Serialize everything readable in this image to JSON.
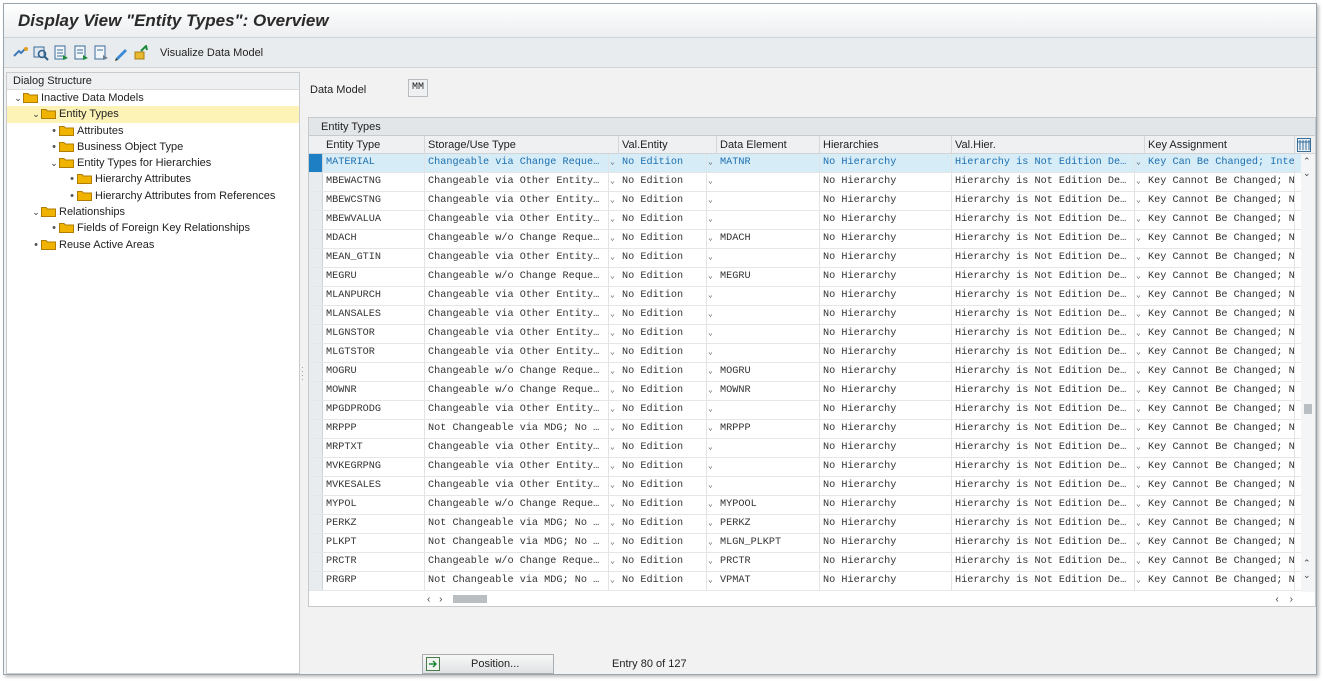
{
  "window": {
    "title": "Display View \"Entity Types\": Overview"
  },
  "toolbar": {
    "visualize_label": "Visualize Data Model"
  },
  "tree": {
    "header": "Dialog Structure",
    "items": [
      {
        "label": "Inactive Data Models",
        "level": 0,
        "expander": "open"
      },
      {
        "label": "Entity Types",
        "level": 1,
        "expander": "open",
        "selected": true
      },
      {
        "label": "Attributes",
        "level": 2,
        "expander": "leaf"
      },
      {
        "label": "Business Object Type",
        "level": 2,
        "expander": "leaf"
      },
      {
        "label": "Entity Types for Hierarchies",
        "level": 2,
        "expander": "open"
      },
      {
        "label": "Hierarchy Attributes",
        "level": 3,
        "expander": "leaf"
      },
      {
        "label": "Hierarchy Attributes from References",
        "level": 3,
        "expander": "leaf"
      },
      {
        "label": "Relationships",
        "level": 1,
        "expander": "open"
      },
      {
        "label": "Fields of Foreign Key Relationships",
        "level": 2,
        "expander": "leaf"
      },
      {
        "label": "Reuse Active Areas",
        "level": 1,
        "expander": "leaf"
      }
    ]
  },
  "data_model": {
    "label": "Data Model",
    "value": "MM"
  },
  "table": {
    "caption": "Entity Types",
    "columns": [
      "Entity Type",
      "Storage/Use Type",
      "Val.Entity",
      "Data Element",
      "Hierarchies",
      "Val.Hier.",
      "Key Assignment"
    ],
    "rows": [
      [
        "MATERIAL",
        "Changeable via Change Reque…",
        "No Edition",
        "MATNR",
        "No Hierarchy",
        "Hierarchy is Not Edition De…",
        "Key Can Be Changed; Inte"
      ],
      [
        "MBEWACTNG",
        "Changeable via Other Entity…",
        "No Edition",
        "",
        "No Hierarchy",
        "Hierarchy is Not Edition De…",
        "Key Cannot Be Changed; N"
      ],
      [
        "MBEWCSTNG",
        "Changeable via Other Entity…",
        "No Edition",
        "",
        "No Hierarchy",
        "Hierarchy is Not Edition De…",
        "Key Cannot Be Changed; N"
      ],
      [
        "MBEWVALUA",
        "Changeable via Other Entity…",
        "No Edition",
        "",
        "No Hierarchy",
        "Hierarchy is Not Edition De…",
        "Key Cannot Be Changed; N"
      ],
      [
        "MDACH",
        "Changeable w/o Change Reque…",
        "No Edition",
        "MDACH",
        "No Hierarchy",
        "Hierarchy is Not Edition De…",
        "Key Cannot Be Changed; N"
      ],
      [
        "MEAN_GTIN",
        "Changeable via Other Entity…",
        "No Edition",
        "",
        "No Hierarchy",
        "Hierarchy is Not Edition De…",
        "Key Cannot Be Changed; N"
      ],
      [
        "MEGRU",
        "Changeable w/o Change Reque…",
        "No Edition",
        "MEGRU",
        "No Hierarchy",
        "Hierarchy is Not Edition De…",
        "Key Cannot Be Changed; N"
      ],
      [
        "MLANPURCH",
        "Changeable via Other Entity…",
        "No Edition",
        "",
        "No Hierarchy",
        "Hierarchy is Not Edition De…",
        "Key Cannot Be Changed; N"
      ],
      [
        "MLANSALES",
        "Changeable via Other Entity…",
        "No Edition",
        "",
        "No Hierarchy",
        "Hierarchy is Not Edition De…",
        "Key Cannot Be Changed; N"
      ],
      [
        "MLGNSTOR",
        "Changeable via Other Entity…",
        "No Edition",
        "",
        "No Hierarchy",
        "Hierarchy is Not Edition De…",
        "Key Cannot Be Changed; N"
      ],
      [
        "MLGTSTOR",
        "Changeable via Other Entity…",
        "No Edition",
        "",
        "No Hierarchy",
        "Hierarchy is Not Edition De…",
        "Key Cannot Be Changed; N"
      ],
      [
        "MOGRU",
        "Changeable w/o Change Reque…",
        "No Edition",
        "MOGRU",
        "No Hierarchy",
        "Hierarchy is Not Edition De…",
        "Key Cannot Be Changed; N"
      ],
      [
        "MOWNR",
        "Changeable w/o Change Reque…",
        "No Edition",
        "MOWNR",
        "No Hierarchy",
        "Hierarchy is Not Edition De…",
        "Key Cannot Be Changed; N"
      ],
      [
        "MPGDPRODG",
        "Changeable via Other Entity…",
        "No Edition",
        "",
        "No Hierarchy",
        "Hierarchy is Not Edition De…",
        "Key Cannot Be Changed; N"
      ],
      [
        "MRPPP",
        "Not Changeable via MDG; No …",
        "No Edition",
        "MRPPP",
        "No Hierarchy",
        "Hierarchy is Not Edition De…",
        "Key Cannot Be Changed; N"
      ],
      [
        "MRPTXT",
        "Changeable via Other Entity…",
        "No Edition",
        "",
        "No Hierarchy",
        "Hierarchy is Not Edition De…",
        "Key Cannot Be Changed; N"
      ],
      [
        "MVKEGRPNG",
        "Changeable via Other Entity…",
        "No Edition",
        "",
        "No Hierarchy",
        "Hierarchy is Not Edition De…",
        "Key Cannot Be Changed; N"
      ],
      [
        "MVKESALES",
        "Changeable via Other Entity…",
        "No Edition",
        "",
        "No Hierarchy",
        "Hierarchy is Not Edition De…",
        "Key Cannot Be Changed; N"
      ],
      [
        "MYPOL",
        "Changeable w/o Change Reque…",
        "No Edition",
        "MYPOOL",
        "No Hierarchy",
        "Hierarchy is Not Edition De…",
        "Key Cannot Be Changed; N"
      ],
      [
        "PERKZ",
        "Not Changeable via MDG; No …",
        "No Edition",
        "PERKZ",
        "No Hierarchy",
        "Hierarchy is Not Edition De…",
        "Key Cannot Be Changed; N"
      ],
      [
        "PLKPT",
        "Not Changeable via MDG; No …",
        "No Edition",
        "MLGN_PLKPT",
        "No Hierarchy",
        "Hierarchy is Not Edition De…",
        "Key Cannot Be Changed; N"
      ],
      [
        "PRCTR",
        "Changeable w/o Change Reque…",
        "No Edition",
        "PRCTR",
        "No Hierarchy",
        "Hierarchy is Not Edition De…",
        "Key Cannot Be Changed; N"
      ],
      [
        "PRGRP",
        "Not Changeable via MDG; No …",
        "No Edition",
        "VPMAT",
        "No Hierarchy",
        "Hierarchy is Not Edition De…",
        "Key Cannot Be Changed; N"
      ]
    ]
  },
  "footer": {
    "position_label": "Position...",
    "entry_text": "Entry 80 of 127"
  },
  "colors": {
    "selected_row": "#d6ecf7",
    "selected_tree": "#fdf3b6",
    "folder": "#f0b400",
    "accent": "#1f7fc4"
  }
}
